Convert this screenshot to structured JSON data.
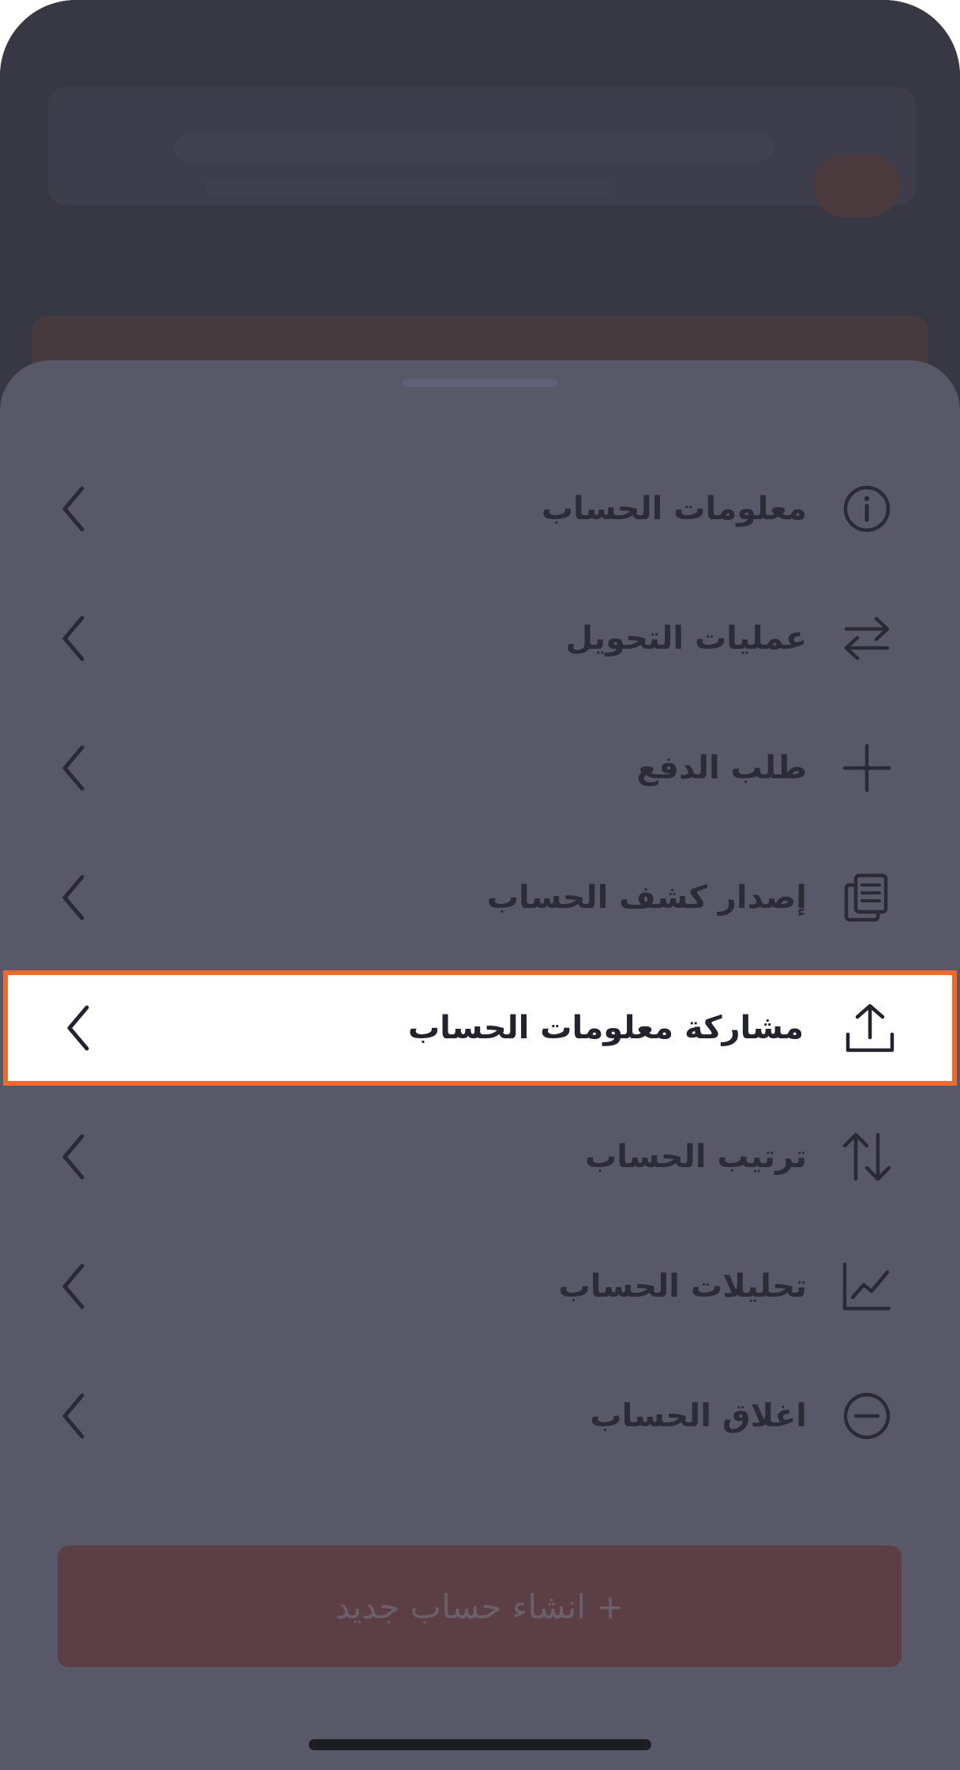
{
  "menu": {
    "items": [
      {
        "label": "معلومات الحساب",
        "icon": "info-icon"
      },
      {
        "label": "عمليات التحويل",
        "icon": "transfer-arrows-icon"
      },
      {
        "label": "طلب الدفع",
        "icon": "plus-icon"
      },
      {
        "label": "إصدار كشف الحساب",
        "icon": "document-copy-icon"
      },
      {
        "label": "مشاركة معلومات الحساب",
        "icon": "share-upload-icon",
        "highlighted": true
      },
      {
        "label": "ترتيب الحساب",
        "icon": "sort-arrows-icon"
      },
      {
        "label": "تحليلات الحساب",
        "icon": "chart-line-icon"
      },
      {
        "label": "اغلاق الحساب",
        "icon": "minus-circle-icon"
      }
    ]
  },
  "create_button": {
    "label": "+ انشاء حساب جديد"
  },
  "colors": {
    "highlight_border": "#f06a2e",
    "sheet_background": "#585868",
    "create_button_background": "#5b3f45"
  }
}
